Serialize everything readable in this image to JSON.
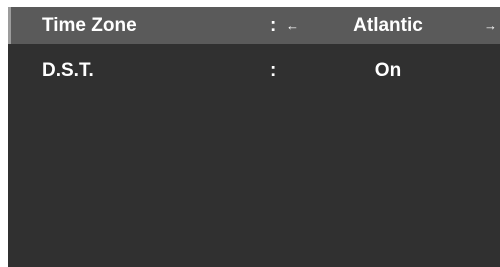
{
  "settings": {
    "rows": [
      {
        "label": "Time Zone",
        "separator": ":",
        "value": "Atlantic",
        "left_arrow_icon": "arrow-left-icon",
        "right_arrow_icon": "arrow-right-icon",
        "selected": true
      },
      {
        "label": "D.S.T.",
        "separator": ":",
        "value": "On",
        "selected": false
      }
    ]
  },
  "arrows": {
    "left": "←",
    "right": "→"
  },
  "colors": {
    "panel_background": "#303030",
    "selected_row_background": "#5a5a5a",
    "focus_bar": "#9c9c9c",
    "text": "#ffffff"
  }
}
